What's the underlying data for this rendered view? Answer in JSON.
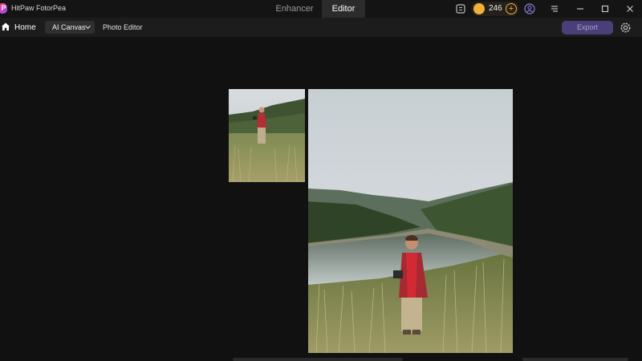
{
  "app": {
    "title": "HitPaw FotorPea",
    "logo_letter": "P"
  },
  "mode_tabs": [
    {
      "label": "Enhancer",
      "active": false
    },
    {
      "label": "Editor",
      "active": true
    }
  ],
  "credits": {
    "count": "246",
    "plus": "+"
  },
  "toolbar": {
    "home_label": "Home",
    "ai_canvas_label": "AI Canvas",
    "photo_editor_label": "Photo Editor",
    "export_label": "Export"
  },
  "colors": {
    "accent": "#4b3f7a",
    "coin": "#f0b03a",
    "background": "#111111"
  },
  "icons": [
    "feedback-icon",
    "coin-icon",
    "account-icon",
    "menu-icon",
    "minimize-icon",
    "maximize-icon",
    "close-icon",
    "home-icon",
    "chevron-down-icon",
    "settings-icon"
  ]
}
